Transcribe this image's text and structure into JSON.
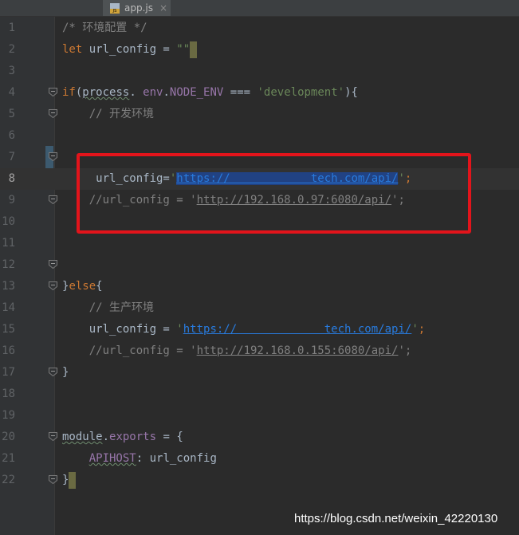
{
  "tab": {
    "name": "app.js",
    "icon": "js-file-icon",
    "badge": "JS",
    "close": "×"
  },
  "lines": [
    {
      "n": "1",
      "parts": [
        [
          "cm",
          "/* 环境配置 */"
        ]
      ]
    },
    {
      "n": "2",
      "parts": [
        [
          "kw",
          "let "
        ],
        [
          "",
          "url_config = "
        ],
        [
          "str",
          "\"\""
        ],
        [
          "caret",
          ""
        ]
      ]
    },
    {
      "n": "3",
      "parts": []
    },
    {
      "n": "4",
      "fold": true,
      "parts": [
        [
          "kw",
          "if"
        ],
        [
          "",
          "("
        ],
        [
          "squig",
          "process"
        ],
        [
          "",
          ". "
        ],
        [
          "var",
          "env"
        ],
        [
          "",
          "."
        ],
        [
          "var",
          "NODE_ENV"
        ],
        [
          "",
          " === "
        ],
        [
          "str",
          "'development'"
        ],
        [
          "",
          "){"
        ]
      ]
    },
    {
      "n": "5",
      "fold": true,
      "parts": [
        [
          "",
          "    "
        ],
        [
          "cm",
          "// 开发环境"
        ]
      ]
    },
    {
      "n": "6",
      "parts": []
    },
    {
      "n": "7",
      "fold": true,
      "parts": []
    },
    {
      "n": "8",
      "current": true,
      "parts": [
        [
          "",
          "     url_config="
        ],
        [
          "str",
          "'"
        ],
        [
          "sellink",
          "https://            tech.com/api/"
        ],
        [
          "str",
          "'"
        ],
        [
          "kw",
          ";"
        ]
      ]
    },
    {
      "n": "9",
      "fold": true,
      "parts": [
        [
          "",
          "    "
        ],
        [
          "cm",
          "//url_config = '"
        ],
        [
          "cmlink",
          "http://192.168.0.97:6080/api/"
        ],
        [
          "cm",
          "';"
        ]
      ]
    },
    {
      "n": "10",
      "parts": []
    },
    {
      "n": "11",
      "parts": []
    },
    {
      "n": "12",
      "fold": true,
      "parts": []
    },
    {
      "n": "13",
      "fold": true,
      "parts": [
        [
          "",
          "}"
        ],
        [
          "kw",
          "else"
        ],
        [
          "",
          "{"
        ]
      ]
    },
    {
      "n": "14",
      "parts": [
        [
          "",
          "    "
        ],
        [
          "cm",
          "// 生产环境"
        ]
      ]
    },
    {
      "n": "15",
      "parts": [
        [
          "",
          "    url_config = "
        ],
        [
          "str",
          "'"
        ],
        [
          "link",
          "https://             tech.com/api/"
        ],
        [
          "str",
          "'"
        ],
        [
          "kw",
          ";"
        ]
      ]
    },
    {
      "n": "16",
      "parts": [
        [
          "",
          "    "
        ],
        [
          "cm",
          "//url_config = '"
        ],
        [
          "cmlink",
          "http://192.168.0.155:6080/api/"
        ],
        [
          "cm",
          "';"
        ]
      ]
    },
    {
      "n": "17",
      "fold": true,
      "parts": [
        [
          "",
          "}"
        ]
      ]
    },
    {
      "n": "18",
      "parts": []
    },
    {
      "n": "19",
      "parts": []
    },
    {
      "n": "20",
      "fold": true,
      "parts": [
        [
          "squig",
          "module"
        ],
        [
          "",
          "."
        ],
        [
          "var",
          "exports"
        ],
        [
          "",
          " = {"
        ]
      ]
    },
    {
      "n": "21",
      "parts": [
        [
          "",
          "    "
        ],
        [
          "squigvar",
          "APIHOST"
        ],
        [
          "",
          ": url_config"
        ]
      ]
    },
    {
      "n": "22",
      "fold": true,
      "parts": [
        [
          "",
          "}"
        ],
        [
          "caret",
          ""
        ]
      ]
    }
  ],
  "watermark": "https://blog.csdn.net/weixin_42220130",
  "colors": {
    "background": "#2b2b2b",
    "keyword": "#cc7832",
    "string": "#6a8759",
    "comment": "#808080",
    "link": "#287bde",
    "highlight_box": "#e3141b"
  }
}
